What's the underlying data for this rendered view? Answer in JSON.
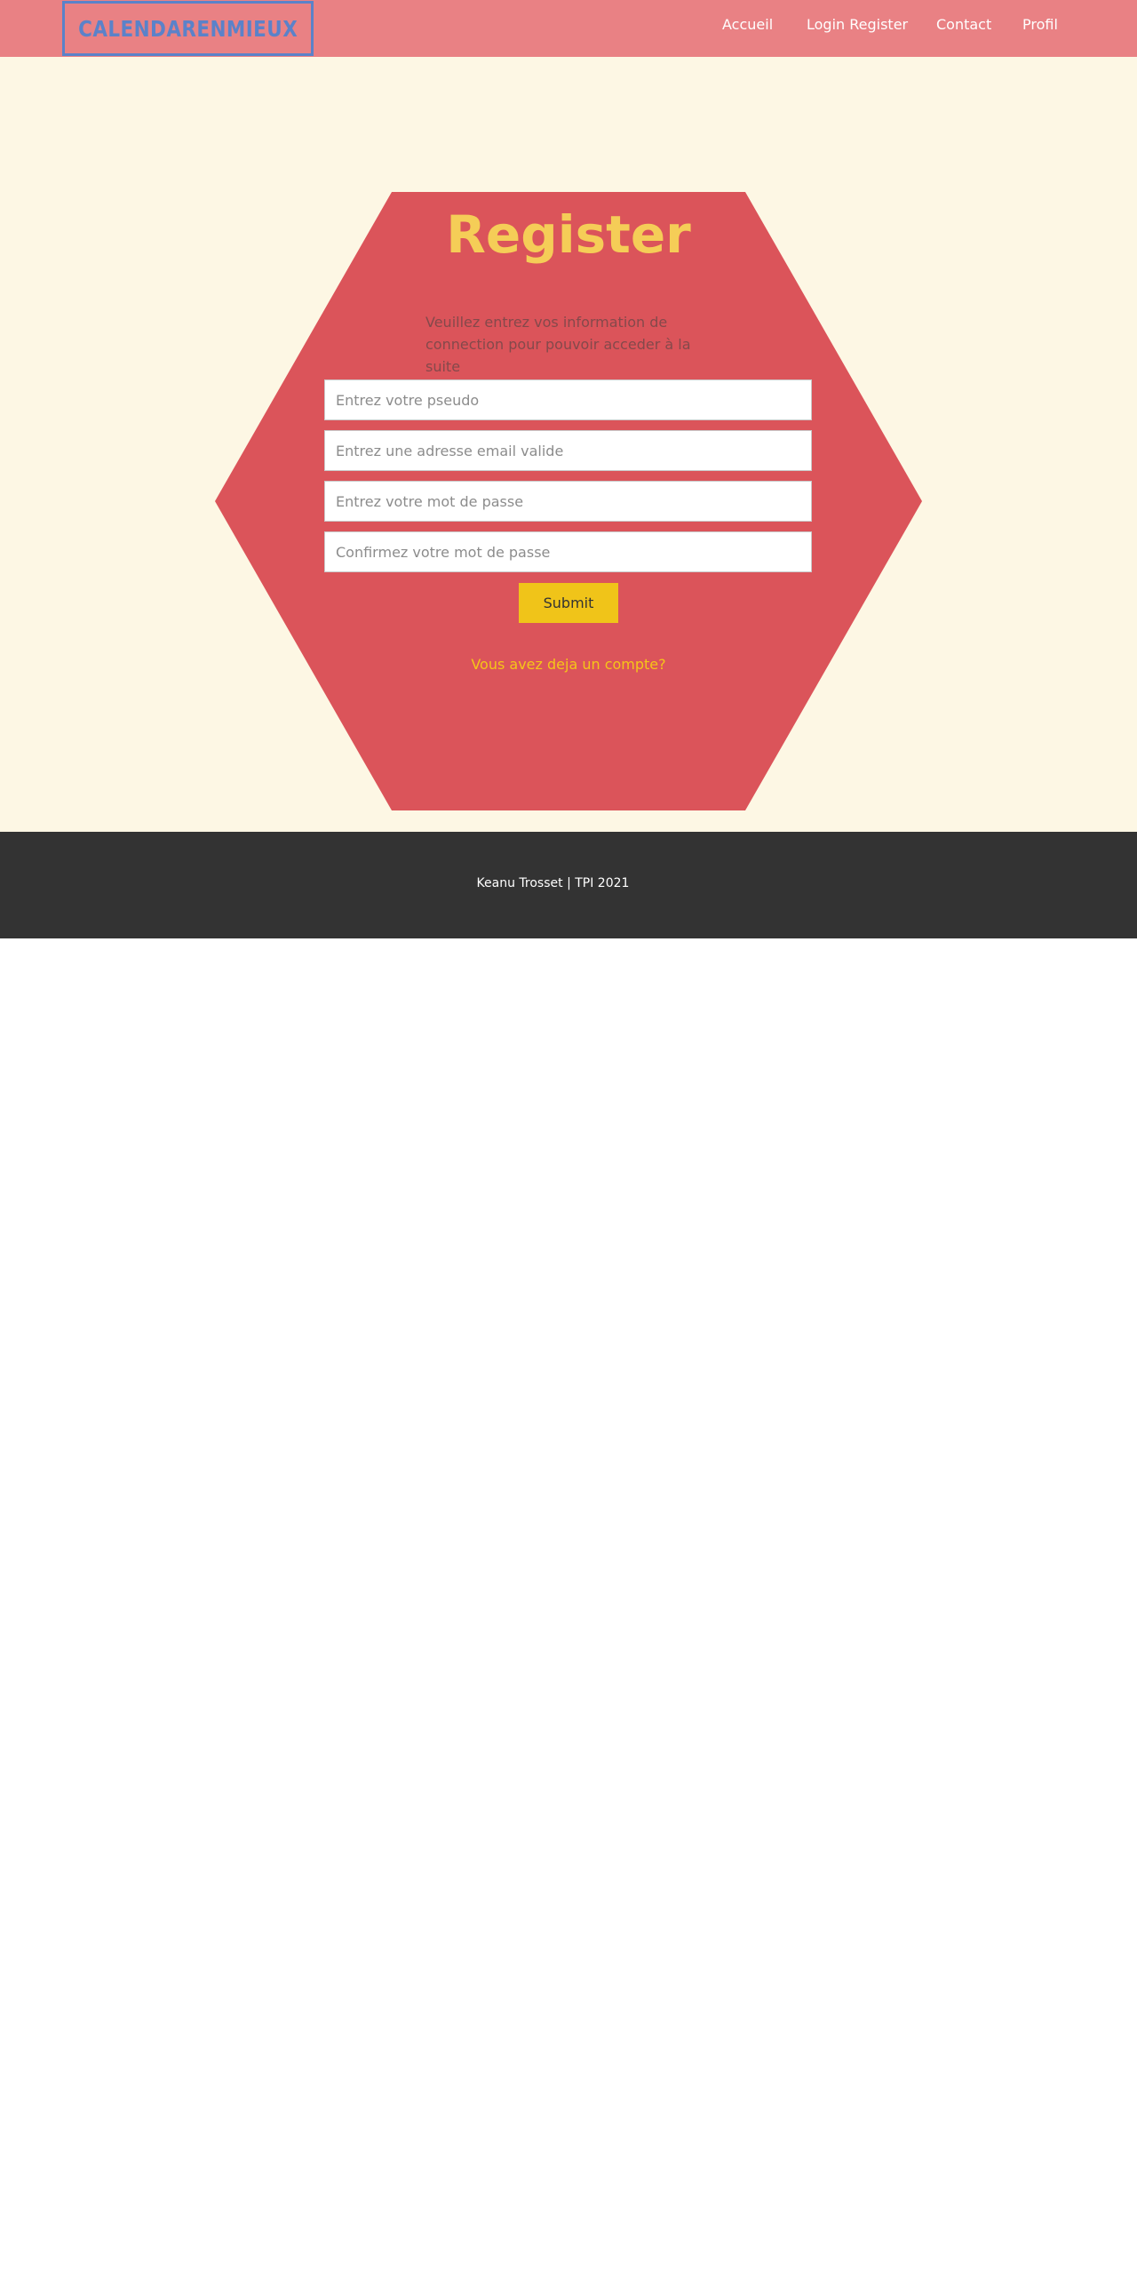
{
  "navbar": {
    "logo": "CALENDARENMIEUX",
    "links": [
      {
        "label": "Accueil"
      },
      {
        "label": "Login Register"
      },
      {
        "label": "Contact"
      },
      {
        "label": "Profil"
      }
    ]
  },
  "register": {
    "title": "Register",
    "intro": "Veuillez entrez vos information de connection pour pouvoir acceder à la suite",
    "fields": {
      "pseudo": {
        "placeholder": "Entrez votre pseudo",
        "value": ""
      },
      "email": {
        "placeholder": "Entrez une adresse email valide",
        "value": ""
      },
      "password": {
        "placeholder": "Entrez votre mot de passe",
        "value": ""
      },
      "confirm": {
        "placeholder": "Confirmez votre mot de passe",
        "value": ""
      }
    },
    "submit_label": "Submit",
    "login_link": "Vous avez deja un compte?"
  },
  "footer": {
    "text": "Keanu Trosset | TPI 2021"
  },
  "colors": {
    "navbar_bg": "#e98184",
    "logo": "#5b82c9",
    "page_bg": "#fdf7e4",
    "hexagon": "#db545a",
    "title": "#f5cd57",
    "submit_bg": "#f0c419",
    "link": "#f5c518",
    "footer_bg": "#333333"
  }
}
